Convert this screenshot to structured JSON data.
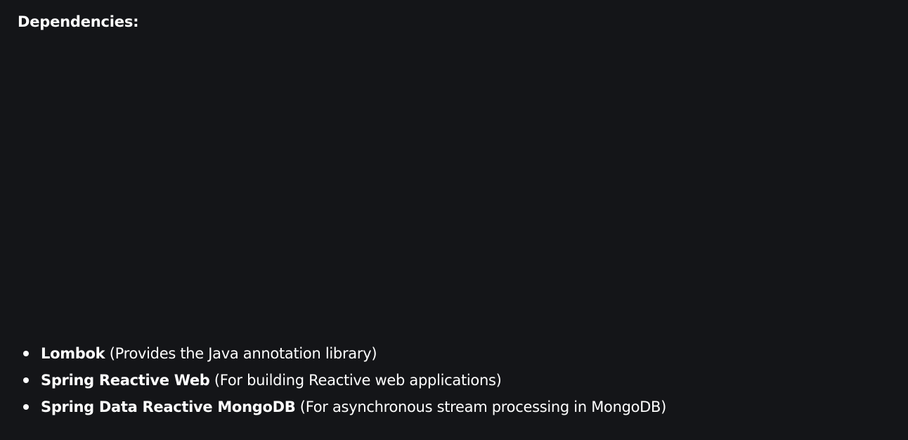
{
  "heading": "Dependencies:",
  "dependencies": [
    {
      "name": "Lombok",
      "description": " (Provides the Java annotation library)"
    },
    {
      "name": "Spring Reactive Web",
      "description": " (For building Reactive web applications)"
    },
    {
      "name": "Spring Data Reactive MongoDB",
      "description": " (For asynchronous stream processing in MongoDB)"
    }
  ],
  "colors": {
    "background": "#141518",
    "text": "#ffffff"
  }
}
